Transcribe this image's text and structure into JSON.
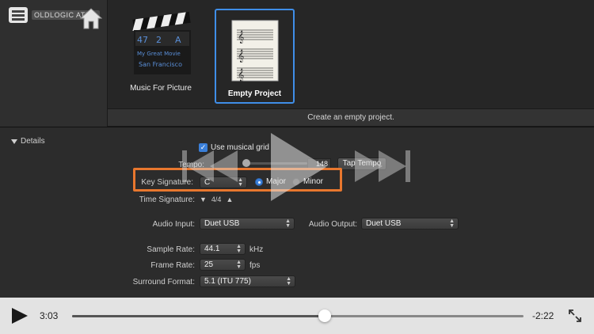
{
  "header": {
    "brand_text": "OLDLOGIC ATE..."
  },
  "chooser": {
    "tiles": [
      {
        "label": "Music For Picture",
        "clapper": {
          "top_row": [
            "47",
            "2",
            "A"
          ],
          "title": "My Great Movie",
          "subtitle": "San Francisco"
        }
      },
      {
        "label": "Empty Project"
      }
    ],
    "description": "Create an empty project."
  },
  "details": {
    "heading": "Details",
    "use_musical_grid_label": "Use musical grid",
    "tempo_label": "Tempo:",
    "tempo_value": "148",
    "tap_tempo_label": "Tap Tempo",
    "key_signature_label": "Key Signature:",
    "key_value": "C",
    "major_label": "Major",
    "minor_label": "Minor",
    "time_signature_label": "Time Signature:",
    "time_signature_value": "4/4",
    "audio_input_label": "Audio Input:",
    "audio_input_value": "Duet USB",
    "audio_output_label": "Audio Output:",
    "audio_output_value": "Duet USB",
    "sample_rate_label": "Sample Rate:",
    "sample_rate_value": "44.1",
    "sample_rate_unit": "kHz",
    "frame_rate_label": "Frame Rate:",
    "frame_rate_value": "25",
    "frame_rate_unit": "fps",
    "surround_format_label": "Surround Format:",
    "surround_format_value": "5.1 (ITU 775)"
  },
  "player": {
    "current_time": "3:03",
    "remaining_time": "-2:22",
    "progress": 0.56
  },
  "colors": {
    "accent": "#3f8ee8",
    "highlight": "#e8772e"
  }
}
